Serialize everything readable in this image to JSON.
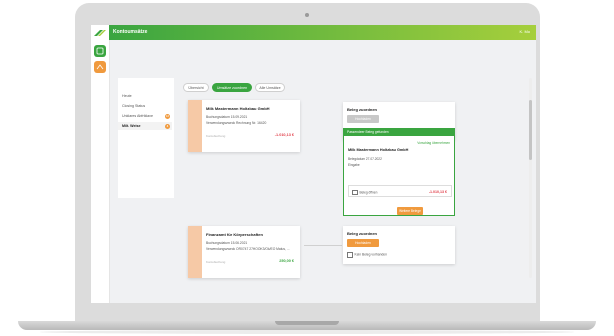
{
  "app": {
    "title": "Kontoumsätze",
    "user": "K. Mo"
  },
  "sidebar": {
    "items": [
      {
        "label": "Heute",
        "active": false
      },
      {
        "label": "Closing Status",
        "active": false
      },
      {
        "label": "Unklares Abfrtklaxe",
        "badge": "16",
        "active": false
      },
      {
        "label": "Milt. Weise",
        "badge": "4",
        "active": true
      }
    ]
  },
  "tabs": [
    {
      "label": "Übersicht",
      "active": false
    },
    {
      "label": "Umsätze zuordnen",
      "active": true
    },
    {
      "label": "Alle Umsätze",
      "active": false
    }
  ],
  "transactions": [
    {
      "title": "Milk Mastermann Holtzbau GmbH",
      "line1": "Buchungsdatum 15.09.2021",
      "line2": "Verwendungszweck Rechnung Nr. 16420",
      "foot": "Kontobuchung",
      "amount": "-1.010,13 €",
      "amount_color": "#e1404b"
    },
    {
      "title": "Finanzamt für Körperschaften",
      "line1": "Buchungsdatum 15.06.2021",
      "line2": "Verwendungszweck OR0747 27HOOK3/Ok/EO Malus, ...",
      "foot": "Kontobuchung",
      "amount": "250,00 €",
      "amount_color": "#3aa540"
    }
  ],
  "beleg_cards": [
    {
      "title": "Beleg zuordnen",
      "button": "Hochladen",
      "checkbox": "Kein Beleg vorhanden"
    },
    {
      "title": "Beleg zuordnen",
      "button": "Hochladen",
      "checkbox": "Kein Beleg vorhanden"
    }
  ],
  "suggestion": {
    "header": "Passendeer Beleg gefunden",
    "tag": "Vorschlag übernehmen",
    "title": "Milk Mastermann Holtzbau GmbH",
    "line1": "Belegdatum 27.07.2022",
    "line2": "Eingabe",
    "check_label": "Beleg öffnen",
    "amount": "-1.010,13 €",
    "button": "Weitere Belege"
  }
}
